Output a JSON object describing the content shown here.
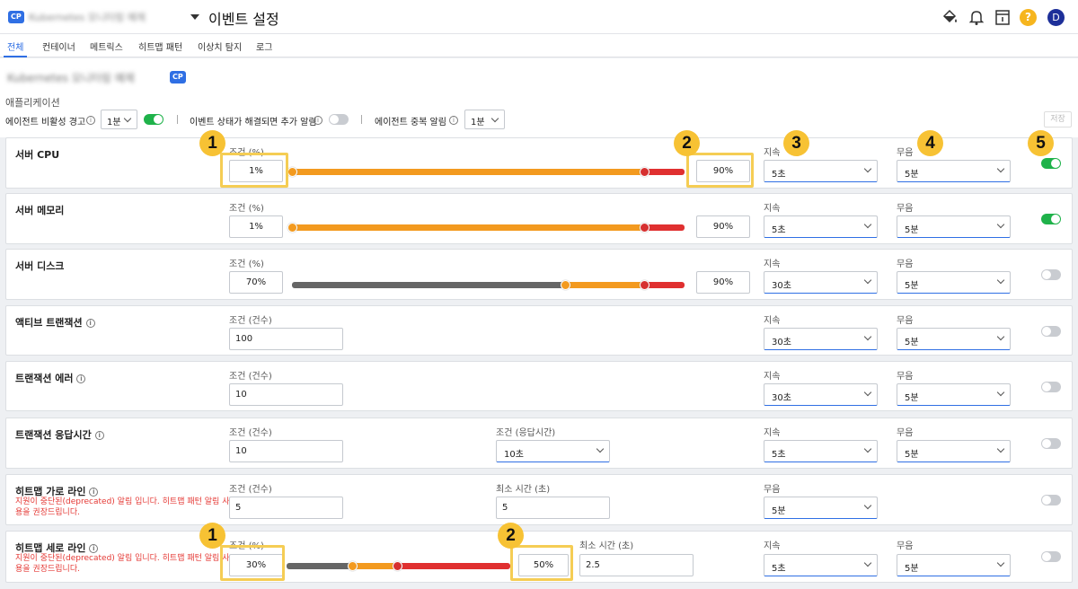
{
  "topbar": {
    "badge": "CP",
    "project_name_blurred": "Kubernetes 모니터링 예제",
    "page_title": "이벤트 설정",
    "help_glyph": "?",
    "avatar_letter": "D",
    "icons": [
      "paint-bucket-icon",
      "bell-icon",
      "document-icon",
      "help-icon",
      "avatar"
    ]
  },
  "tabs": [
    "전체",
    "컨테이너",
    "메트릭스",
    "히트맵 패턴",
    "이상치 탐지",
    "로그"
  ],
  "project_heading": {
    "name_blurred": "Kubernetes 모니터링 예제",
    "badge": "CP"
  },
  "section": {
    "label": "애플리케이션"
  },
  "options": {
    "inactive_alert_label": "에이전트 비활성 경고",
    "inactive_alert_interval": "1분",
    "resolve_alert_label": "이벤트 상태가 해결되면 추가 알림",
    "duplicate_alert_label": "에이전트 중복 알림",
    "duplicate_alert_interval": "1분",
    "save_label": "저장"
  },
  "labels": {
    "cond_pct": "조건 (%)",
    "cond_count": "조건 (건수)",
    "cond_resp": "조건 (응답시간)",
    "duration": "지속",
    "mute": "무음",
    "min_time": "최소 시간 (초)"
  },
  "rows": [
    {
      "name": "서버 CPU",
      "low": "1%",
      "high": "90%",
      "duration": "5초",
      "mute": "5분",
      "enabled": true
    },
    {
      "name": "서버 메모리",
      "low": "1%",
      "high": "90%",
      "duration": "5초",
      "mute": "5분",
      "enabled": true
    },
    {
      "name": "서버 디스크",
      "low": "70%",
      "high": "90%",
      "duration": "30초",
      "mute": "5분",
      "enabled": false
    },
    {
      "name": "액티브 트랜잭션",
      "value": "100",
      "duration": "30초",
      "mute": "5분",
      "enabled": false
    },
    {
      "name": "트랜잭션 에러",
      "value": "10",
      "duration": "30초",
      "mute": "5분",
      "enabled": false
    },
    {
      "name": "트랜잭션 응답시간",
      "value": "10",
      "resp": "10초",
      "duration": "5초",
      "mute": "5분",
      "enabled": false
    },
    {
      "name": "히트맵 가로 라인",
      "desc": "지원이 중단된(deprecated) 알림 입니다. 히트맵 패턴 알림 사용을 권장드립니다.",
      "value": "5",
      "min_time": "5",
      "mute": "5분",
      "enabled": false
    },
    {
      "name": "히트맵 세로 라인",
      "desc": "지원이 중단된(deprecated) 알림 입니다. 히트맵 패턴 알림 사용을 권장드립니다.",
      "low": "30%",
      "high": "50%",
      "min_time": "2.5",
      "duration": "5초",
      "mute": "5분",
      "enabled": false
    }
  ],
  "callouts": [
    "1",
    "2",
    "3",
    "4",
    "5",
    "1",
    "2"
  ],
  "colors": {
    "accent": "#2f6fe4",
    "toggle_on": "#1fb24a",
    "slider_orange": "#f39a1f",
    "slider_red": "#e03030",
    "slider_gray": "#666666",
    "callout": "#f7c234",
    "deprecated_text": "#e53935"
  }
}
